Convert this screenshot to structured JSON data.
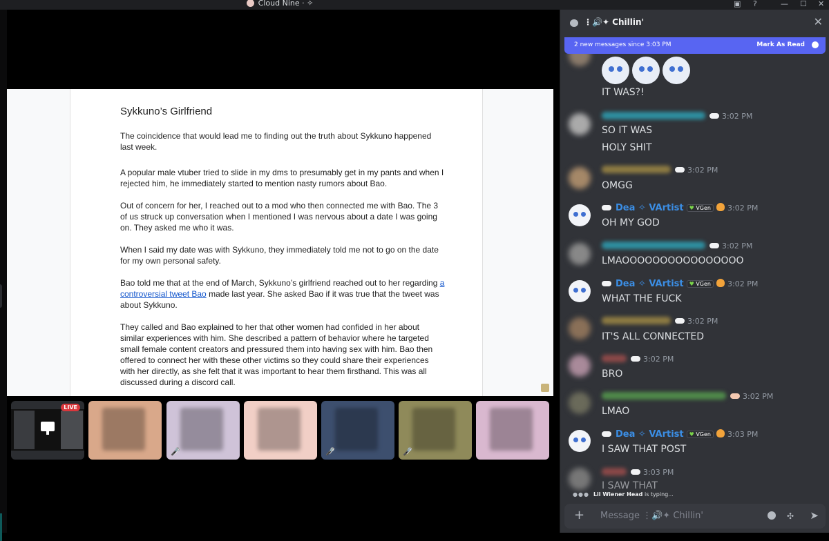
{
  "window": {
    "title": "Cloud Nine · ✧",
    "min": "—",
    "max": "☐",
    "close": "✕"
  },
  "document": {
    "title": "Sykkuno’s Girlfriend",
    "paragraphs": [
      "The coincidence that would lead me to finding out the truth about Sykkuno happened last week.",
      "A popular male vtuber tried to slide in my dms to presumably get in my pants and when I rejected him, he immediately started to mention nasty rumors about Bao.",
      "Out of concern for her, I reached out to a mod who then connected me with Bao. The 3 of us struck up conversation when I mentioned I was nervous about a date I was going on. They asked me who it was.",
      "When I said my date was with Sykkuno, they immediately told me not to go on the date for my own personal safety."
    ],
    "p5_before": "Bao told me that at the end of March, Sykkuno’s girlfriend reached out to her regarding ",
    "p5_link": "a controversial tweet Bao",
    "p5_after": " made last year. She asked Bao if it was true that the tweet was about Sykkuno.",
    "p6": "They called and Bao explained to her that other women had confided in her about similar experiences with him. She described a pattern of behavior where he targeted small female content creators and pressured them into having sex with him. Bao then offered to connect her with these other victims so they could share their experiences with her directly, as she felt that it was important to hear them firsthand. This was all discussed during a discord call."
  },
  "tiles": {
    "live_label": "LIVE",
    "mute_icon": "🎤̸",
    "colors": [
      "#d9a88a",
      "#cfc3d8",
      "#f1cfc6",
      "#3d4f6e",
      "#8f8a5a",
      "#d9b8cf"
    ]
  },
  "chat": {
    "channel": "⋮🔊✦ Chillin'",
    "close": "✕",
    "new_banner": "2 new messages since 3:03 PM",
    "mark_read": "Mark As Read",
    "dea_name": "Dea ✧ VArtist",
    "vgen": "VGen",
    "messages": [
      {
        "time": "",
        "lines": [
          "IT WAS?!"
        ]
      },
      {
        "time": "3:02 PM",
        "lines": [
          "SO IT WAS",
          "HOLY SHIT"
        ]
      },
      {
        "time": "3:02 PM",
        "lines": [
          "OMGG"
        ]
      },
      {
        "time": "3:02 PM",
        "lines": [
          "OH MY GOD"
        ]
      },
      {
        "time": "3:02 PM",
        "lines": [
          "LMAOOOOOOOOOOOOOOOO"
        ]
      },
      {
        "time": "3:02 PM",
        "lines": [
          "WHAT THE FUCK"
        ]
      },
      {
        "time": "3:02 PM",
        "lines": [
          "IT'S ALL CONNECTED"
        ]
      },
      {
        "time": "3:02 PM",
        "lines": [
          "BRO"
        ]
      },
      {
        "time": "3:02 PM",
        "lines": [
          "LMAO"
        ]
      },
      {
        "time": "3:03 PM",
        "lines": [
          "I SAW THAT POST"
        ]
      },
      {
        "time": "3:03 PM",
        "lines": [
          "I SAW THAT"
        ]
      }
    ],
    "typing_user": "Lil Wiener Head",
    "typing_suffix": " is typing...",
    "composer_placeholder": "Message ⋮🔊✦ Chillin'",
    "plus": "+",
    "apps_icon": "✣",
    "send_icon": "➤"
  }
}
